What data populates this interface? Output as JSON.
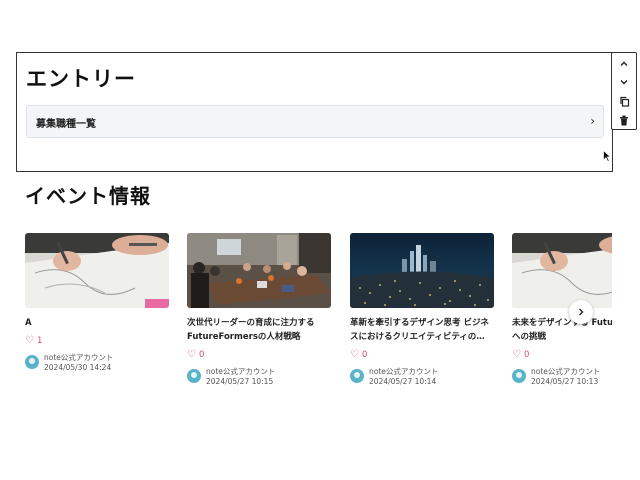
{
  "entry": {
    "title": "エントリー",
    "row_label": "募集職種一覧",
    "row_chevron": "›"
  },
  "toolbar": {
    "up_icon": "⌃",
    "down_icon": "⌄",
    "copy_icon": "⧉",
    "delete_icon": "🗑"
  },
  "events": {
    "title": "イベント情報",
    "cards": [
      {
        "title": "A",
        "likes": "1",
        "author": "note公式アカウント",
        "date": "2024/05/30 14:24"
      },
      {
        "title": "次世代リーダーの育成に注力する FutureFormersの人材戦略",
        "likes": "0",
        "author": "note公式アカウント",
        "date": "2024/05/27 10:15"
      },
      {
        "title": "革新を牽引するデザイン思考 ビジネスにおけるクリエイティビティの…",
        "likes": "0",
        "author": "note公式アカウント",
        "date": "2024/05/27 10:14"
      },
      {
        "title": "未来をデザインする Futu の新時代への挑戦",
        "likes": "0",
        "author": "note公式アカウント",
        "date": "2024/05/27 10:13"
      }
    ],
    "next_icon": "›"
  }
}
